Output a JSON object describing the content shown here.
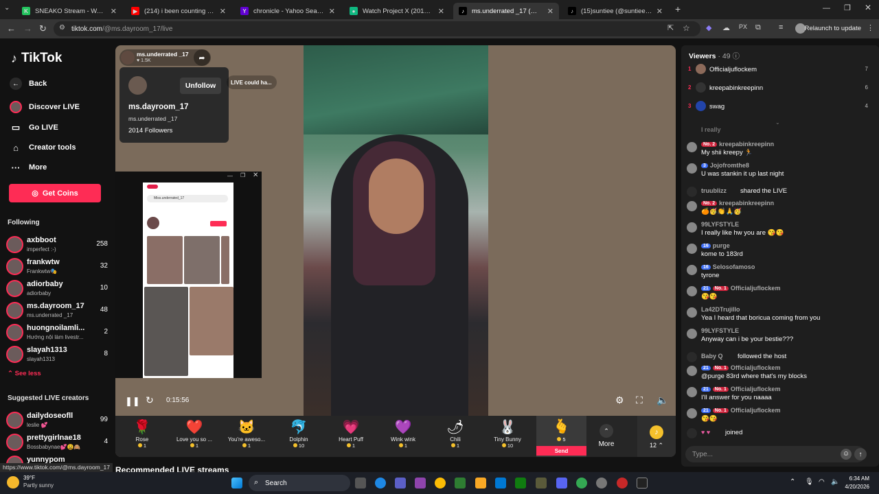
{
  "browser": {
    "tabs": [
      {
        "title": "SNEAKO Stream - Watch Live o",
        "color": "#22c55e",
        "letter": "K"
      },
      {
        "title": "(214) i been counting paper i g",
        "color": "#ff0000",
        "letter": "▶"
      },
      {
        "title": "chronicle - Yahoo Search Resul",
        "color": "#6001d2",
        "letter": "Y"
      },
      {
        "title": "Watch Project X (2012) For Fre",
        "color": "#10b981",
        "letter": "●"
      },
      {
        "title": "ms.underrated _17 (@ms.d",
        "color": "#000000",
        "letter": "♪"
      },
      {
        "title": "(15)suntiee (@suntiee) | TikTok",
        "color": "#000000",
        "letter": "♪"
      }
    ],
    "url_host": "tiktok.com",
    "url_path": "/@ms.dayroom_17/live",
    "relaunch": "Relaunch to update"
  },
  "sidebar": {
    "logo": "TikTok",
    "back": "Back",
    "nav": [
      {
        "label": "Discover LIVE",
        "icon": "live-icon"
      },
      {
        "label": "Go LIVE",
        "icon": "camera-icon"
      },
      {
        "label": "Creator tools",
        "icon": "home-icon"
      },
      {
        "label": "More",
        "icon": "more-icon"
      }
    ],
    "coins": "Get Coins",
    "following_title": "Following",
    "following": [
      {
        "name": "axbboot",
        "sub": "imperfect :-)",
        "count": "258"
      },
      {
        "name": "frankwtw",
        "sub": "Frankwtw🎭",
        "count": "32"
      },
      {
        "name": "adiorbaby",
        "sub": "adiorbaby",
        "count": "10"
      },
      {
        "name": "ms.dayroom_17",
        "sub": "ms.underrated _17",
        "count": "48"
      },
      {
        "name": "huongnoilamli...",
        "sub": "Hướng nội làm livestr...",
        "count": "2"
      },
      {
        "name": "slayah1313",
        "sub": "slayah1313",
        "count": "8"
      }
    ],
    "see_less": "See less",
    "suggested_title": "Suggested LIVE creators",
    "suggested": [
      {
        "name": "dailydoseofll",
        "sub": "leslie 💕",
        "count": "99"
      },
      {
        "name": "prettygirlnae18",
        "sub": "Bossbabynae💕😩🙈",
        "count": "4"
      },
      {
        "name": "yunnypom",
        "sub": "",
        "count": ""
      }
    ]
  },
  "video": {
    "host_name": "ms.underrated _17",
    "likes": "1.5K",
    "popup": {
      "unfollow": "Unfollow",
      "username": "ms.dayroom_17",
      "nickname": "ms.underrated _17",
      "followers": "2014 Followers"
    },
    "banner": "LIVE could ha...",
    "timer": "0:15:56",
    "phone_search": "Miss.underrated_17"
  },
  "gifts": [
    {
      "name": "Rose",
      "price": "1",
      "emoji": "🌹"
    },
    {
      "name": "Love you so ...",
      "price": "1",
      "emoji": "❤️"
    },
    {
      "name": "You're aweso...",
      "price": "1",
      "emoji": "🐱"
    },
    {
      "name": "Dolphin",
      "price": "10",
      "emoji": "🐬"
    },
    {
      "name": "Heart Puff",
      "price": "1",
      "emoji": "💗"
    },
    {
      "name": "Wink wink",
      "price": "1",
      "emoji": "💜"
    },
    {
      "name": "Chili",
      "price": "1",
      "emoji": "🌶"
    },
    {
      "name": "Tiny Bunny",
      "price": "10",
      "emoji": "🐰"
    }
  ],
  "send_gift": {
    "price": "5",
    "label": "Send",
    "emoji": "🫰"
  },
  "more_label": "More",
  "coin_balance": "12",
  "recommended": "Recommended LIVE streams",
  "chat": {
    "viewers_label": "Viewers",
    "viewers_count": "· 49",
    "top": [
      {
        "rank": "1",
        "name": "Officialjuflockem",
        "score": "7"
      },
      {
        "rank": "2",
        "name": "kreepabinkreepinn",
        "score": "6"
      },
      {
        "rank": "3",
        "name": "swag",
        "score": "4"
      }
    ],
    "messages": [
      {
        "user": "I really",
        "text": "",
        "badges": []
      },
      {
        "user": "kreepabinkreepinn",
        "text": "My shii kreepy 🏃",
        "badges": [
          "No. 2"
        ]
      },
      {
        "user": "Jojofromthe8",
        "text": "U was stankin it up last night",
        "badges": [
          "3"
        ]
      },
      {
        "user": "truublizz",
        "text": "shared the LIVE",
        "badges": []
      },
      {
        "user": "kreepabinkreepinn",
        "text": "🍊🥳👏🙏🥳",
        "badges": [
          "No. 2"
        ]
      },
      {
        "user": "99LYFSTYLE",
        "text": "I really like hw you are 😘😘",
        "badges": []
      },
      {
        "user": "purge",
        "text": "kome to 183rd",
        "badges": [
          "16"
        ]
      },
      {
        "user": "Selosofamoso",
        "text": "tyrone",
        "badges": [
          "16"
        ]
      },
      {
        "user": "Officialjuflockem",
        "text": "😘😘",
        "badges": [
          "21",
          "No. 1"
        ]
      },
      {
        "user": "La42DTrujillo",
        "text": "Yea I heard that boricua coming from you",
        "badges": []
      },
      {
        "user": "99LYFSTYLE",
        "text": "Anyway can i be your bestie???",
        "badges": []
      },
      {
        "user": "Baby Q",
        "text": "followed the host",
        "badges": []
      },
      {
        "user": "Officialjuflockem",
        "text": "@purge 83rd where that's my blocks",
        "badges": [
          "21",
          "No. 1"
        ]
      },
      {
        "user": "Officialjuflockem",
        "text": "I'll answer for you naaaa",
        "badges": [
          "21",
          "No. 1"
        ]
      },
      {
        "user": "Officialjuflockem",
        "text": "😘😘",
        "badges": [
          "21",
          "No. 1"
        ]
      },
      {
        "user": "",
        "text": "joined",
        "badges": []
      }
    ],
    "input_placeholder": "Type..."
  },
  "status_url": "https://www.tiktok.com/@ms.dayroom_17",
  "taskbar": {
    "temp": "39°F",
    "weather": "Partly sunny",
    "search": "Search",
    "time": "6:34 AM",
    "date": "4/20/2026"
  },
  "colors": {
    "accent": "#fe2c55",
    "coin": "#f5c12c",
    "badge_blue": "#3e6ef5"
  }
}
